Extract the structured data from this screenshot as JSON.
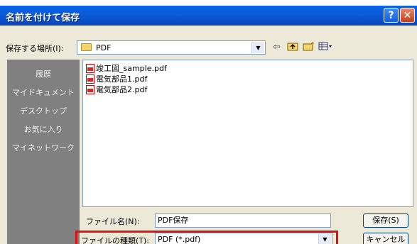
{
  "colors": {
    "titlebar": "#0b5ad8",
    "places_bar": "#808080",
    "highlight": "#e01010"
  },
  "dialog": {
    "title": "名前を付けて保存",
    "help_button": "?",
    "close_button": "✕"
  },
  "save_in": {
    "label": "保存する場所(I):",
    "value": "PDF",
    "toolbar_icons": [
      "back-icon",
      "up-folder-icon",
      "new-folder-icon",
      "view-menu-icon"
    ]
  },
  "places": [
    "履歴",
    "マイドキュメント",
    "デスクトップ",
    "お気に入り",
    "マイネットワーク"
  ],
  "files": [
    "竣工図_sample.pdf",
    "電気部品1.pdf",
    "電気部品2.pdf"
  ],
  "file_name": {
    "label": "ファイル名(N):",
    "value": "PDF保存"
  },
  "file_type": {
    "label": "ファイルの種類(T):",
    "value": "PDF (*.pdf)"
  },
  "buttons": {
    "save": "保存(S)",
    "cancel": "キャンセル"
  }
}
